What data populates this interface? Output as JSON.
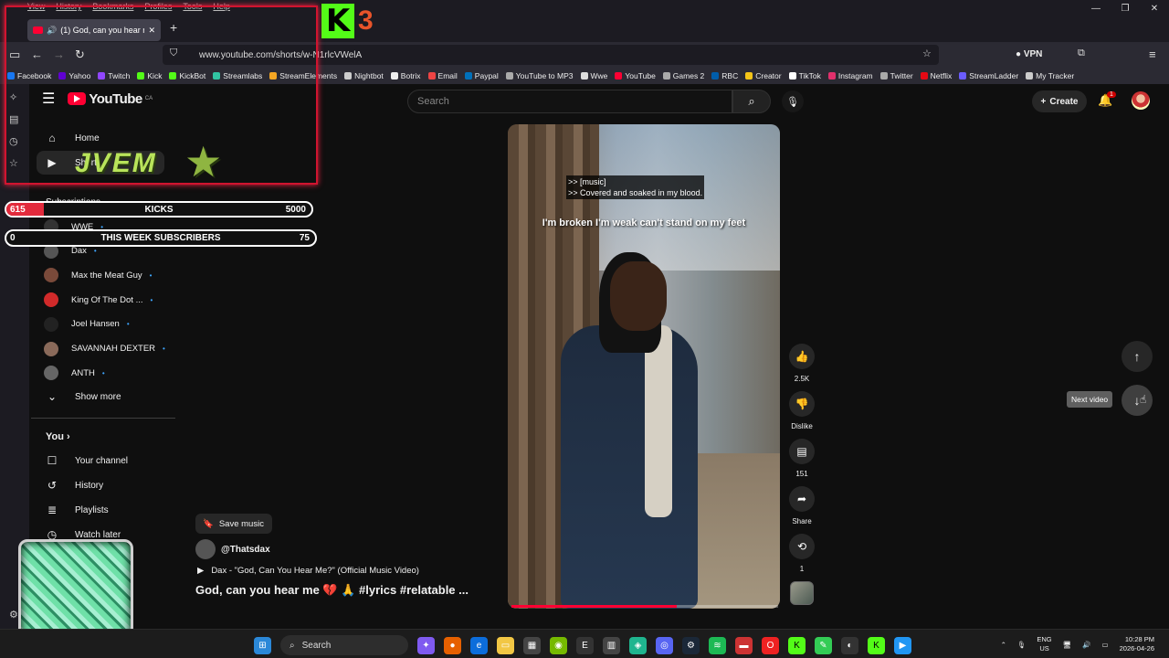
{
  "browser": {
    "menu_items": [
      "View",
      "History",
      "Bookmarks",
      "Profiles",
      "Tools",
      "Help"
    ],
    "tab_title": "(1) God, can you hear me",
    "url": "www.youtube.com/shorts/w-N1rlcVWelA",
    "vpn_label": "VPN",
    "bookmarks": [
      {
        "label": "Facebook",
        "color": "#1877f2"
      },
      {
        "label": "Yahoo",
        "color": "#6001d2"
      },
      {
        "label": "Twitch",
        "color": "#9146ff"
      },
      {
        "label": "Kick",
        "color": "#53fc18"
      },
      {
        "label": "KickBot",
        "color": "#53fc18"
      },
      {
        "label": "Streamlabs",
        "color": "#31c3a2"
      },
      {
        "label": "StreamElements",
        "color": "#f5a623"
      },
      {
        "label": "Nightbot",
        "color": "#cccccc"
      },
      {
        "label": "Botrix",
        "color": "#eeeeee"
      },
      {
        "label": "Email",
        "color": "#e44"
      },
      {
        "label": "Paypal",
        "color": "#0070ba"
      },
      {
        "label": "YouTube to MP3",
        "color": "#aaaaaa"
      },
      {
        "label": "Wwe",
        "color": "#dddddd"
      },
      {
        "label": "YouTube",
        "color": "#ff0033"
      },
      {
        "label": "Games 2",
        "color": "#aaaaaa"
      },
      {
        "label": "RBC",
        "color": "#005daa"
      },
      {
        "label": "Creator",
        "color": "#f5c518"
      },
      {
        "label": "TikTok",
        "color": "#ffffff"
      },
      {
        "label": "Instagram",
        "color": "#e1306c"
      },
      {
        "label": "Twitter",
        "color": "#aaaaaa"
      },
      {
        "label": "Netflix",
        "color": "#e50914"
      },
      {
        "label": "StreamLadder",
        "color": "#6b5cff"
      },
      {
        "label": "My Tracker",
        "color": "#cccccc"
      }
    ]
  },
  "overlay": {
    "brand_number": "3",
    "logo_text": "JVEM",
    "kicks": {
      "current": "615",
      "label": "KICKS",
      "goal": "5000",
      "progress": 0.123
    },
    "subs": {
      "current": "0",
      "label": "THIS WEEK SUBSCRIBERS",
      "goal": "75"
    }
  },
  "youtube": {
    "logo_text": "YouTube",
    "region": "CA",
    "search_placeholder": "Search",
    "create_label": "Create",
    "notification_count": "1",
    "sidebar": {
      "home": "Home",
      "shorts": "Shorts",
      "subscriptions": "Subscriptions",
      "subs": [
        {
          "name": "WWE",
          "color": "#333333"
        },
        {
          "name": "Dax",
          "color": "#555555"
        },
        {
          "name": "Max the Meat Guy",
          "color": "#7a4a3a"
        },
        {
          "name": "King Of The Dot ...",
          "color": "#d12a2a"
        },
        {
          "name": "Joel Hansen",
          "color": "#222222"
        },
        {
          "name": "SAVANNAH DEXTER",
          "color": "#8a6a5a"
        },
        {
          "name": "ANTH",
          "color": "#666666"
        }
      ],
      "show_more": "Show more",
      "you": "You",
      "your_channel": "Your channel",
      "history": "History",
      "playlists": "Playlists",
      "watch_later": "Watch later"
    },
    "short": {
      "caption_line1": ">> [music]",
      "caption_line2": ">> Covered and soaked in my blood.",
      "lyric": "I'm broken I'm weak can't stand on my feet",
      "progress": 0.62,
      "likes": "2.5K",
      "dislike": "Dislike",
      "comments": "151",
      "share": "Share",
      "remix": "1",
      "save_music": "Save music",
      "channel": "@Thatsdax",
      "song": "Dax - \"God, Can You Hear Me?\" (Official Music Video)",
      "title": "God, can you hear me 💔 🙏 #lyrics #relatable ..."
    },
    "next_video_tooltip": "Next video"
  },
  "taskbar": {
    "search": "Search",
    "lang_top": "ENG",
    "lang_bottom": "US",
    "time": "10:28 PM",
    "date": "2026-04-26"
  }
}
